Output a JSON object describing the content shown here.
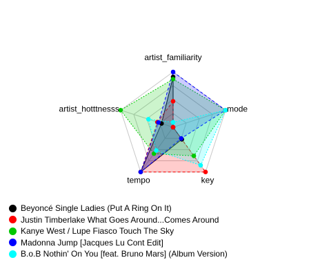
{
  "chart_data": {
    "type": "radar",
    "axes": [
      "artist_familiarity",
      "mode",
      "key",
      "tempo",
      "artist_hotttnesss"
    ],
    "range": [
      0,
      1
    ],
    "grid": true,
    "legend_position": "bottom-left",
    "series": [
      {
        "name": "Beyoncé Single Ladies (Put A Ring On It)",
        "color": "#000000",
        "values": [
          0.91,
          0.0,
          0.27,
          1.0,
          0.22
        ],
        "line": "solid",
        "fill": "#000000"
      },
      {
        "name": "Justin Timberlake What Goes Around...Comes Around",
        "color": "#ff0000",
        "values": [
          0.47,
          0.0,
          1.0,
          1.0,
          0.3
        ],
        "line": "dashed",
        "fill": "#ff0000"
      },
      {
        "name": "Kanye West / Lupe Fiasco Touch The Sky",
        "color": "#00c800",
        "values": [
          0.87,
          1.0,
          0.64,
          0.59,
          1.0
        ],
        "line": "dotted",
        "fill": "#00c800"
      },
      {
        "name": "Madonna Jump [Jacques Lu Cont Edit]",
        "color": "#0000ff",
        "values": [
          1.0,
          1.0,
          0.25,
          1.0,
          0.28
        ],
        "line": "dashed",
        "fill": "#0000ff"
      },
      {
        "name": "B.o.B Nothin' On You [feat. Bruno Mars] (Album Version)",
        "color": "#00ffff",
        "values": [
          0.09,
          1.0,
          0.85,
          0.52,
          0.47
        ],
        "line": "dotted",
        "fill": "#00ffff"
      }
    ]
  }
}
